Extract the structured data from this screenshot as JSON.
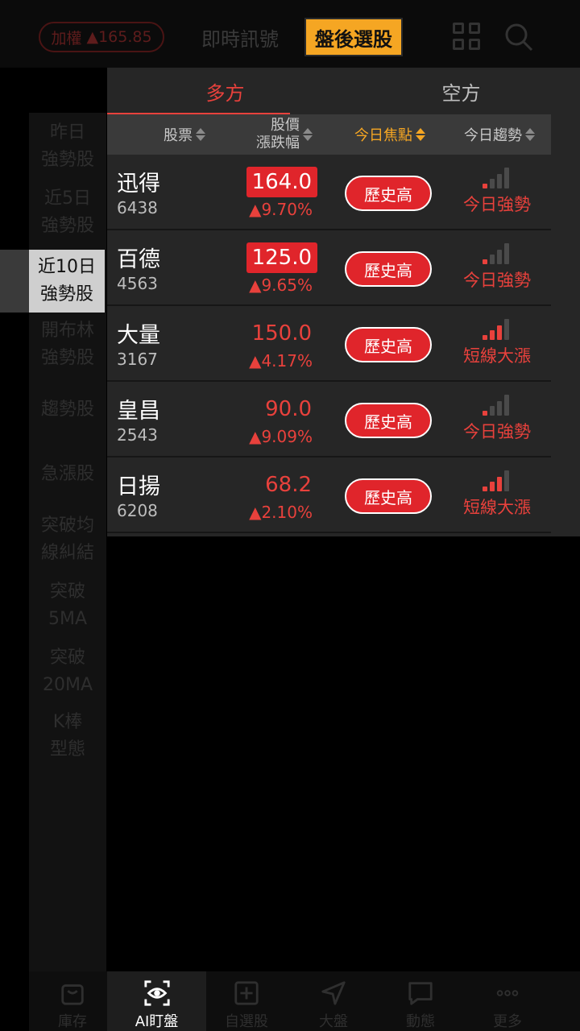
{
  "header": {
    "index_name": "加權",
    "index_change": "▲165.85",
    "tabs": [
      "即時訊號",
      "盤後選股"
    ],
    "active_tab": 1
  },
  "sidebar": {
    "items": [
      "昨日\n強勢股",
      "近5日\n強勢股",
      "近10日\n強勢股",
      "開布林\n強勢股",
      "趨勢股",
      "急漲股",
      "突破均\n線糾結",
      "突破\n5MA",
      "突破\n20MA",
      "K棒\n型態"
    ],
    "active_index": 2
  },
  "segments": {
    "long": "多方",
    "short": "空方"
  },
  "table": {
    "columns": {
      "stock": "股票",
      "price_top": "股價",
      "price_bottom": "漲跌幅",
      "focus": "今日焦點",
      "trend": "今日趨勢"
    },
    "rows": [
      {
        "name": "迅得",
        "code": "6438",
        "price": "164.0",
        "change": "▲9.70%",
        "highlight": true,
        "focus": "歷史高",
        "trend": "今日強勢",
        "trend_level": 1
      },
      {
        "name": "百德",
        "code": "4563",
        "price": "125.0",
        "change": "▲9.65%",
        "highlight": true,
        "focus": "歷史高",
        "trend": "今日強勢",
        "trend_level": 1
      },
      {
        "name": "大量",
        "code": "3167",
        "price": "150.0",
        "change": "▲4.17%",
        "highlight": false,
        "focus": "歷史高",
        "trend": "短線大漲",
        "trend_level": 3
      },
      {
        "name": "皇昌",
        "code": "2543",
        "price": "90.0",
        "change": "▲9.09%",
        "highlight": false,
        "focus": "歷史高",
        "trend": "今日強勢",
        "trend_level": 1
      },
      {
        "name": "日揚",
        "code": "6208",
        "price": "68.2",
        "change": "▲2.10%",
        "highlight": false,
        "focus": "歷史高",
        "trend": "短線大漲",
        "trend_level": 3
      }
    ]
  },
  "tabbar": {
    "items": [
      "庫存",
      "AI盯盤",
      "自選股",
      "大盤",
      "動態",
      "更多"
    ],
    "active_index": 1
  },
  "colors": {
    "accent_red": "#e8413c",
    "highlight_orange": "#f5a623",
    "badge_red": "#e0252b"
  }
}
